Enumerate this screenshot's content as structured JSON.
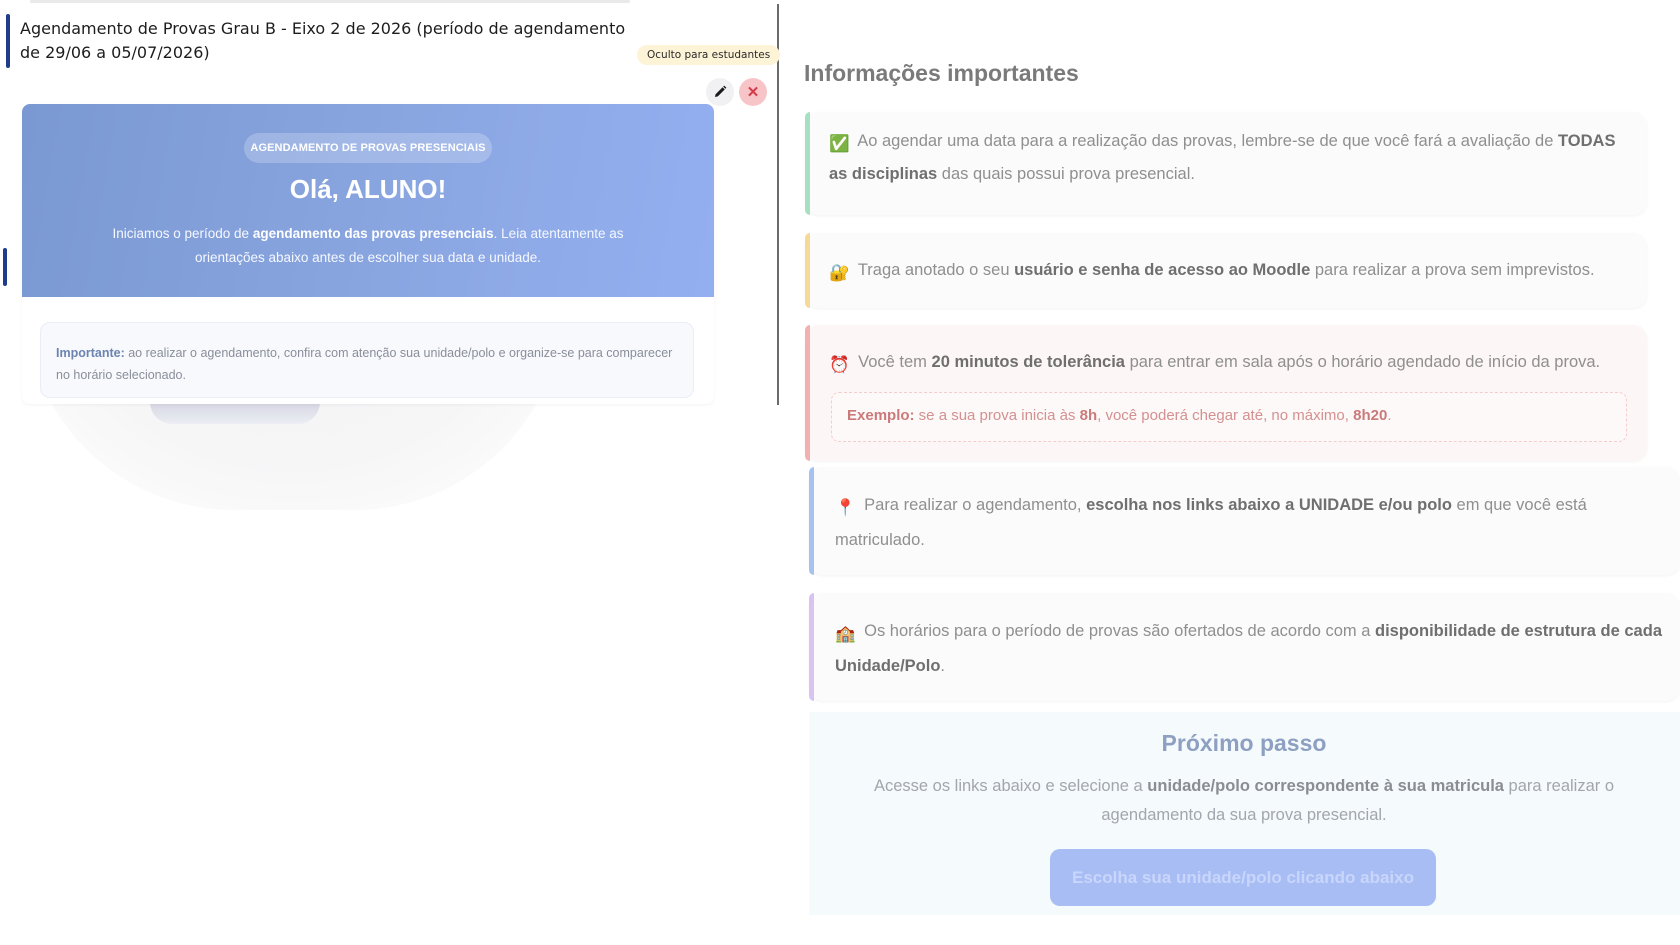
{
  "section": {
    "title": "Agendamento de Provas Grau B - Eixo 2 de 2026 (período de agendamento de 29/06 a 05/07/2026)",
    "visibility_badge": "Oculto para estudantes"
  },
  "hero": {
    "pill": "AGENDAMENTO DE PROVAS PRESENCIAIS",
    "greeting": "Olá, ALUNO!",
    "text_a": "Iniciamos o período de ",
    "text_b": "agendamento das provas presenciais",
    "text_c": ". Leia atentamente as orientações abaixo antes de escolher sua data e unidade."
  },
  "note": {
    "label": "Importante:",
    "text": " ao realizar o agendamento, confira com atenção sua unidade/polo e organize-se para comparecer no horário selecionado."
  },
  "info": {
    "title": "Informações importantes",
    "cards": [
      {
        "icon": "✅",
        "icon_name": "check-mark-icon",
        "a": " Ao agendar uma data para a realização das provas, lembre-se de que você fará a avaliação de ",
        "b": "TODAS as disciplinas",
        "c": " das quais possui prova presencial."
      },
      {
        "icon": "🔐",
        "icon_name": "lock-key-icon",
        "a": " Traga anotado o seu ",
        "b": "usuário e senha de acesso ao Moodle",
        "c": " para realizar a prova sem imprevistos."
      },
      {
        "icon": "⏰",
        "icon_name": "alarm-clock-icon",
        "a": " Você tem ",
        "b": "20 minutos de tolerância",
        "c": " para entrar em sala após o horário agendado de início da prova.",
        "example": {
          "label": "Exemplo:",
          "a": " se a sua prova inicia às ",
          "b": "8h",
          "c": ", você poderá chegar até, no máximo, ",
          "d": "8h20",
          "e": "."
        }
      },
      {
        "icon": "📍",
        "icon_name": "pin-icon",
        "a": " Para realizar o agendamento, ",
        "b": "escolha nos links abaixo a UNIDADE e/ou polo",
        "c": " em que você está matriculado."
      },
      {
        "icon": "🏫",
        "icon_name": "school-icon",
        "a": " Os horários para o período de provas são ofertados de acordo com a ",
        "b": "disponibilidade de estrutura de cada Unidade/Polo",
        "c": "."
      }
    ]
  },
  "next_step": {
    "title": "Próximo passo",
    "a": "Acesse os links abaixo e selecione a ",
    "b": "unidade/polo correspondente à sua matricula",
    "c": " para realizar o agendamento da sua prova presencial.",
    "button": "Escolha sua unidade/polo clicando abaixo"
  },
  "colors": {
    "banner": "#8aa6e1",
    "accent_navy": "#1f3d8a",
    "green_bar": "#a7e0c1",
    "yellow_bar": "#f6d897",
    "red_bar": "#f2b0b0",
    "blue_bar": "#a6c2f1",
    "purple_bar": "#d8c3f1",
    "cta": "#a9bdf5"
  }
}
